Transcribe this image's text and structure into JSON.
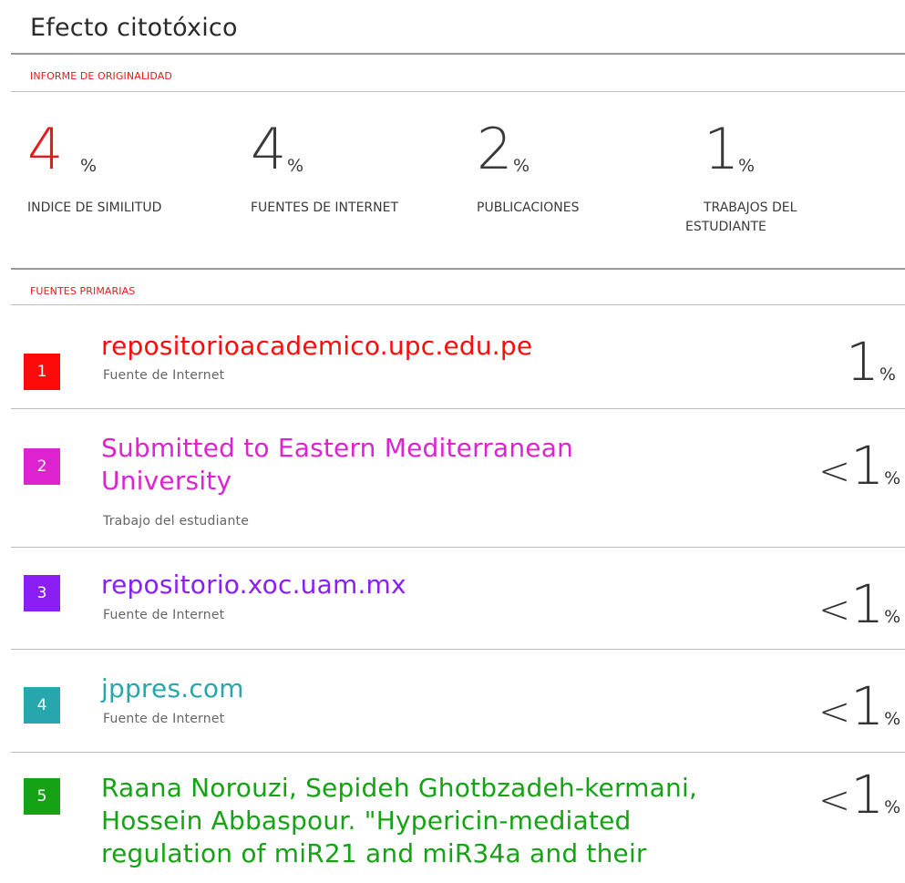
{
  "document": {
    "title": "Efecto citotóxico"
  },
  "report": {
    "section_label": "INFORME DE ORIGINALIDAD",
    "stats": [
      {
        "value": "4",
        "unit": "%",
        "label": "INDICE DE SIMILITUD",
        "color": "#e31b1b"
      },
      {
        "value": "4",
        "unit": "%",
        "label": "FUENTES DE INTERNET",
        "color": "#3a3a3a"
      },
      {
        "value": "2",
        "unit": "%",
        "label": "PUBLICACIONES",
        "color": "#3a3a3a"
      },
      {
        "value": "1",
        "unit": "%",
        "label_line1": "TRABAJOS DEL",
        "label_line2": "ESTUDIANTE",
        "color": "#3a3a3a"
      }
    ]
  },
  "sources": {
    "section_label": "FUENTES PRIMARIAS",
    "items": [
      {
        "number": "1",
        "title": "repositorioacademico.upc.edu.pe",
        "type": "Fuente de Internet",
        "percent_prefix": "",
        "percent_value": "1",
        "percent_unit": "%",
        "color": "#ff0a0a"
      },
      {
        "number": "2",
        "title_line1": "Submitted to Eastern Mediterranean",
        "title_line2": "University",
        "type": "Trabajo del estudiante",
        "percent_prefix": "<",
        "percent_value": "1",
        "percent_unit": "%",
        "color": "#dd22d0"
      },
      {
        "number": "3",
        "title": "repositorio.xoc.uam.mx",
        "type": "Fuente de Internet",
        "percent_prefix": "<",
        "percent_value": "1",
        "percent_unit": "%",
        "color": "#8a1ef5"
      },
      {
        "number": "4",
        "title": "jppres.com",
        "type": "Fuente de Internet",
        "percent_prefix": "<",
        "percent_value": "1",
        "percent_unit": "%",
        "color": "#27a7ad"
      },
      {
        "number": "5",
        "title_line1": "Raana Norouzi, Sepideh Ghotbzadeh-kermani,",
        "title_line2": "Hossein Abbaspour. \"Hypericin-mediated",
        "title_line3": "regulation of miR21 and miR34a and their",
        "percent_prefix": "<",
        "percent_value": "1",
        "percent_unit": "%",
        "color": "#15a315"
      }
    ]
  }
}
